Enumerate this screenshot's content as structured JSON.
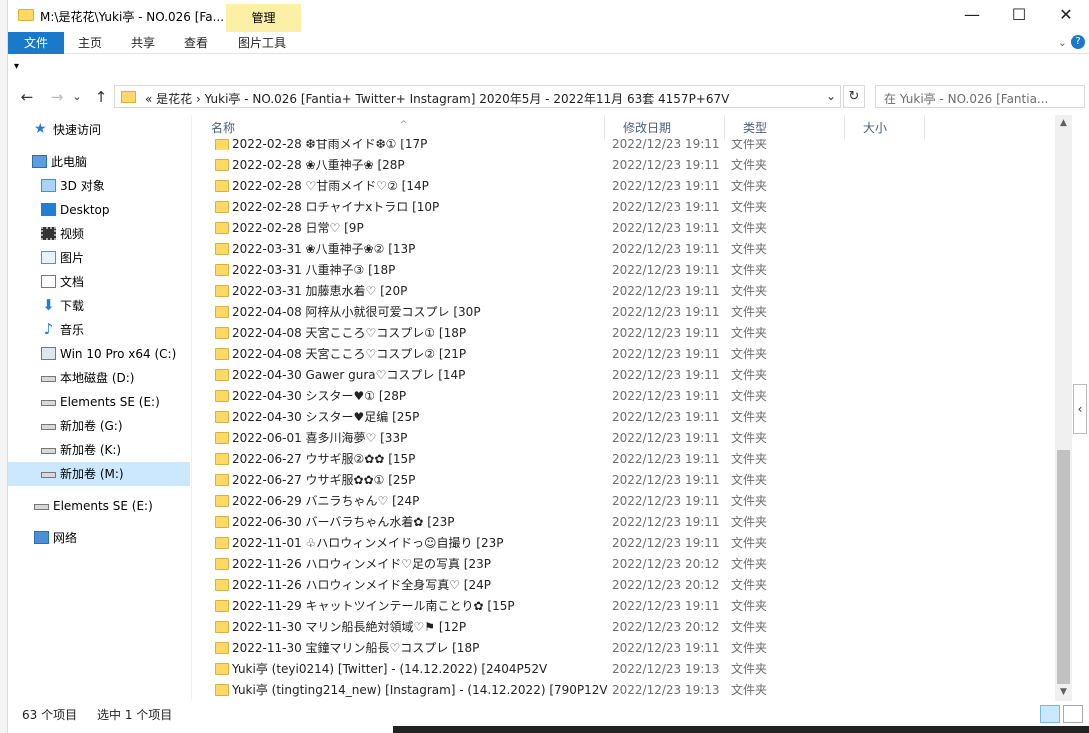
{
  "window": {
    "title": "M:\\是花花\\Yuki亭 - NO.026 [Fa...",
    "manage_tab": "管理",
    "min_symbol": "—",
    "max_symbol": "☐",
    "close_symbol": "✕"
  },
  "ribbon": {
    "tabs": [
      "文件",
      "主页",
      "共享",
      "查看",
      "图片工具"
    ],
    "expand_symbol": "⌄",
    "help_symbol": "?"
  },
  "qat": {
    "dropdown_symbol": "▾"
  },
  "nav": {
    "back_symbol": "←",
    "forward_symbol": "→",
    "recent_symbol": "⌄",
    "up_symbol": "↑",
    "address_text": "«  是花花  ›  Yuki亭 - NO.026 [Fantia+ Twitter+ Instagram]  2020年5月 - 2022年11月 63套  4157P+67V",
    "address_dropdown": "⌄",
    "refresh_symbol": "↻",
    "search_placeholder": "在 Yuki亭 - NO.026 [Fantia..."
  },
  "sidebar": {
    "items": [
      {
        "label": "快速访问",
        "icon": "star-icon"
      },
      {
        "label": "此电脑",
        "icon": "computer-icon"
      },
      {
        "label": "3D 对象",
        "icon": "3d-objects-icon"
      },
      {
        "label": "Desktop",
        "icon": "desktop-icon"
      },
      {
        "label": "视频",
        "icon": "video-icon"
      },
      {
        "label": "图片",
        "icon": "pictures-icon"
      },
      {
        "label": "文档",
        "icon": "documents-icon"
      },
      {
        "label": "下载",
        "icon": "download-icon"
      },
      {
        "label": "音乐",
        "icon": "music-icon"
      },
      {
        "label": "Win 10 Pro x64 (C:)",
        "icon": "windows-drive-icon"
      },
      {
        "label": "本地磁盘 (D:)",
        "icon": "drive-icon"
      },
      {
        "label": "Elements SE (E:)",
        "icon": "drive-icon"
      },
      {
        "label": "新加卷 (G:)",
        "icon": "drive-icon"
      },
      {
        "label": "新加卷 (K:)",
        "icon": "drive-icon"
      },
      {
        "label": "新加卷 (M:)",
        "icon": "drive-icon",
        "selected": true
      },
      {
        "label": "Elements SE (E:)",
        "icon": "drive-icon"
      },
      {
        "label": "网络",
        "icon": "network-icon"
      }
    ],
    "star_glyph": "★",
    "download_glyph": "⬇",
    "music_glyph": "♪"
  },
  "columns": {
    "name": "名称",
    "date": "修改日期",
    "type": "类型",
    "size": "大小",
    "sort_symbol": "^"
  },
  "files": [
    {
      "name": "2022-02-28 ❆甘雨メイド❆① [17P",
      "date": "2022/12/23 19:11",
      "type": "文件夹"
    },
    {
      "name": "2022-02-28 ❀八重神子❀ [28P",
      "date": "2022/12/23 19:11",
      "type": "文件夹"
    },
    {
      "name": "2022-02-28 ♡甘雨メイド♡② [14P",
      "date": "2022/12/23 19:11",
      "type": "文件夹"
    },
    {
      "name": "2022-02-28 ロチャイナxトラロ [10P",
      "date": "2022/12/23 19:11",
      "type": "文件夹"
    },
    {
      "name": "2022-02-28 日常♡ [9P",
      "date": "2022/12/23 19:11",
      "type": "文件夹"
    },
    {
      "name": "2022-03-31 ❀八重神子❀② [13P",
      "date": "2022/12/23 19:11",
      "type": "文件夹"
    },
    {
      "name": "2022-03-31 八重神子③ [18P",
      "date": "2022/12/23 19:11",
      "type": "文件夹"
    },
    {
      "name": "2022-03-31 加藤恵水着♡ [20P",
      "date": "2022/12/23 19:11",
      "type": "文件夹"
    },
    {
      "name": "2022-04-08 阿梓从小就很可爱コスプレ [30P",
      "date": "2022/12/23 19:11",
      "type": "文件夹"
    },
    {
      "name": "2022-04-08 天宮こころ♡コスプレ① [18P",
      "date": "2022/12/23 19:11",
      "type": "文件夹"
    },
    {
      "name": "2022-04-08 天宮こころ♡コスプレ② [21P",
      "date": "2022/12/23 19:11",
      "type": "文件夹"
    },
    {
      "name": "2022-04-30 Gawer gura♡コスプレ [14P",
      "date": "2022/12/23 19:11",
      "type": "文件夹"
    },
    {
      "name": "2022-04-30 シスター♥① [28P",
      "date": "2022/12/23 19:11",
      "type": "文件夹"
    },
    {
      "name": "2022-04-30 シスター♥足编 [25P",
      "date": "2022/12/23 19:11",
      "type": "文件夹"
    },
    {
      "name": "2022-06-01 喜多川海夢♡ [33P",
      "date": "2022/12/23 19:11",
      "type": "文件夹"
    },
    {
      "name": "2022-06-27 ウサギ服②✿✿ [15P",
      "date": "2022/12/23 19:11",
      "type": "文件夹"
    },
    {
      "name": "2022-06-27 ウサギ服✿✿① [25P",
      "date": "2022/12/23 19:11",
      "type": "文件夹"
    },
    {
      "name": "2022-06-29 バニラちゃん♡ [24P",
      "date": "2022/12/23 19:11",
      "type": "文件夹"
    },
    {
      "name": "2022-06-30 バーバラちゃん水着✿ [23P",
      "date": "2022/12/23 19:11",
      "type": "文件夹"
    },
    {
      "name": "2022-11-01 ♧ハロウィンメイドっ☺自撮り [23P",
      "date": "2022/12/23 19:11",
      "type": "文件夹"
    },
    {
      "name": "2022-11-26 ハロウィンメイド♡足の写真 [23P",
      "date": "2022/12/23 20:12",
      "type": "文件夹"
    },
    {
      "name": "2022-11-26 ハロウィンメイド全身写真♡ [24P",
      "date": "2022/12/23 20:12",
      "type": "文件夹"
    },
    {
      "name": "2022-11-29 キャットツインテール南ことり✿ [15P",
      "date": "2022/12/23 19:11",
      "type": "文件夹"
    },
    {
      "name": "2022-11-30 マリン船長絶対領域♡⚑ [12P",
      "date": "2022/12/23 20:12",
      "type": "文件夹"
    },
    {
      "name": "2022-11-30 宝鐘マリン船長♡コスプレ [18P",
      "date": "2022/12/23 19:11",
      "type": "文件夹"
    },
    {
      "name": "Yuki亭 (teyi0214) [Twitter] - (14.12.2022) [2404P52V",
      "date": "2022/12/23 19:13",
      "type": "文件夹"
    },
    {
      "name": "Yuki亭 (tingting214_new) [Instagram] - (14.12.2022) [790P12V",
      "date": "2022/12/23 19:13",
      "type": "文件夹"
    }
  ],
  "scrollbar": {
    "up_symbol": "▲",
    "down_symbol": "▼"
  },
  "side_tab_symbol": "‹",
  "status": {
    "count": "63 个项目",
    "selection": "选中 1 个项目"
  }
}
